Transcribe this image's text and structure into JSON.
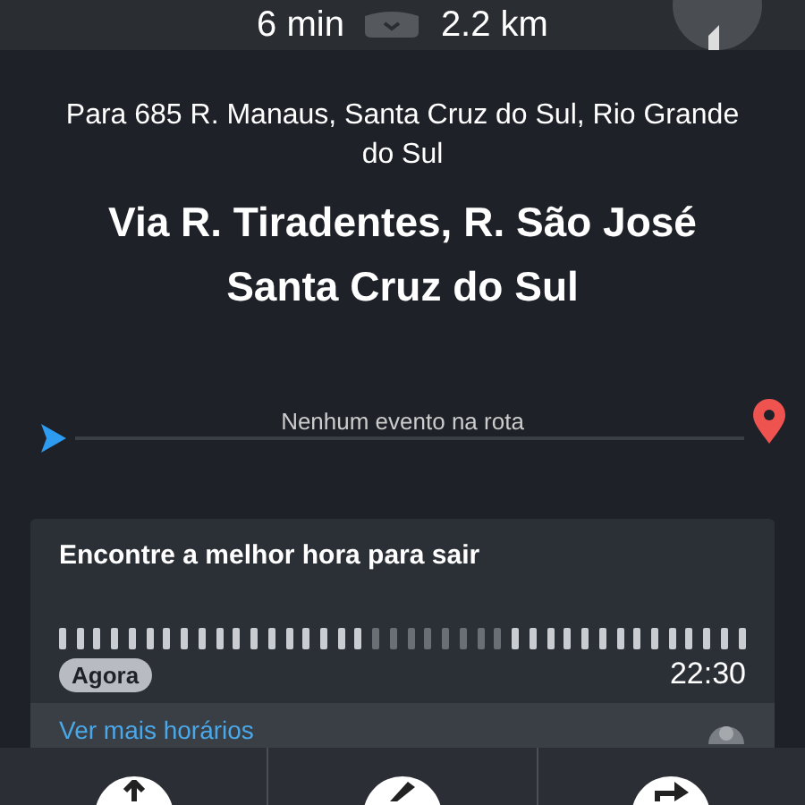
{
  "trip": {
    "duration": "6 min",
    "distance": "2.2 km"
  },
  "destination": {
    "address": "Para 685 R. Manaus, Santa Cruz do Sul, Rio Grande do Sul",
    "via": "Via R. Tiradentes, R. São José",
    "city": "Santa Cruz do Sul"
  },
  "route": {
    "label": "Nenhum evento na rota"
  },
  "departure_card": {
    "title": "Encontre a melhor hora para sair",
    "now_label": "Agora",
    "end_time": "22:30",
    "link": "Ver mais horários",
    "slots": [
      {
        "busy": false
      },
      {
        "busy": false
      },
      {
        "busy": false
      },
      {
        "busy": false
      },
      {
        "busy": false
      },
      {
        "busy": false
      },
      {
        "busy": false
      },
      {
        "busy": false
      },
      {
        "busy": false
      },
      {
        "busy": false
      },
      {
        "busy": false
      },
      {
        "busy": false
      },
      {
        "busy": false
      },
      {
        "busy": false
      },
      {
        "busy": false
      },
      {
        "busy": false
      },
      {
        "busy": false
      },
      {
        "busy": false
      },
      {
        "busy": true
      },
      {
        "busy": true
      },
      {
        "busy": true
      },
      {
        "busy": true
      },
      {
        "busy": true
      },
      {
        "busy": true
      },
      {
        "busy": true
      },
      {
        "busy": true
      },
      {
        "busy": false
      },
      {
        "busy": false
      },
      {
        "busy": false
      },
      {
        "busy": false
      },
      {
        "busy": false
      },
      {
        "busy": false
      },
      {
        "busy": false
      },
      {
        "busy": false
      },
      {
        "busy": false
      },
      {
        "busy": false
      },
      {
        "busy": false
      },
      {
        "busy": false
      },
      {
        "busy": false
      },
      {
        "busy": false
      }
    ]
  },
  "actions": [
    {
      "kind": "route"
    },
    {
      "kind": "edit"
    },
    {
      "kind": "share"
    }
  ]
}
